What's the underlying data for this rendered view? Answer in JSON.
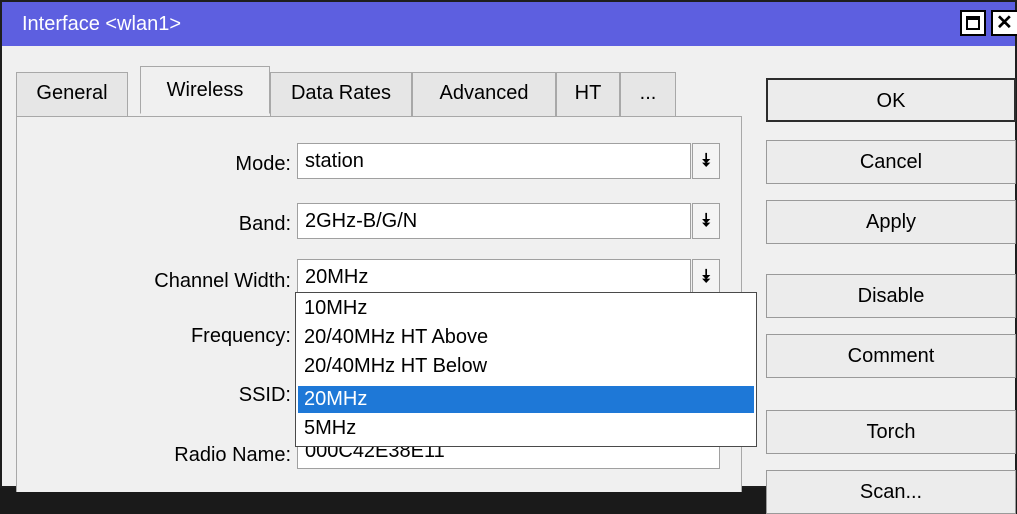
{
  "window": {
    "title": "Interface <wlan1>",
    "close_glyph": "✕"
  },
  "tabs": [
    {
      "label": "General"
    },
    {
      "label": "Wireless",
      "active": true
    },
    {
      "label": "Data Rates"
    },
    {
      "label": "Advanced"
    },
    {
      "label": "HT"
    },
    {
      "label": "..."
    }
  ],
  "form": {
    "mode": {
      "label": "Mode:",
      "value": "station"
    },
    "band": {
      "label": "Band:",
      "value": "2GHz-B/G/N"
    },
    "channel_width": {
      "label": "Channel Width:",
      "value": "20MHz"
    },
    "frequency": {
      "label": "Frequency:"
    },
    "ssid": {
      "label": "SSID:"
    },
    "radio_name": {
      "label": "Radio Name:",
      "value": "000C42E38E11"
    }
  },
  "dropdown": {
    "options": [
      "10MHz",
      "20/40MHz HT Above",
      "20/40MHz HT Below",
      "20MHz",
      "5MHz"
    ],
    "selected": "20MHz"
  },
  "buttons": {
    "ok": "OK",
    "cancel": "Cancel",
    "apply": "Apply",
    "disable": "Disable",
    "comment": "Comment",
    "torch": "Torch",
    "scan": "Scan..."
  },
  "colors": {
    "titlebar": "#5d5fe0",
    "selection": "#1e78d7"
  }
}
